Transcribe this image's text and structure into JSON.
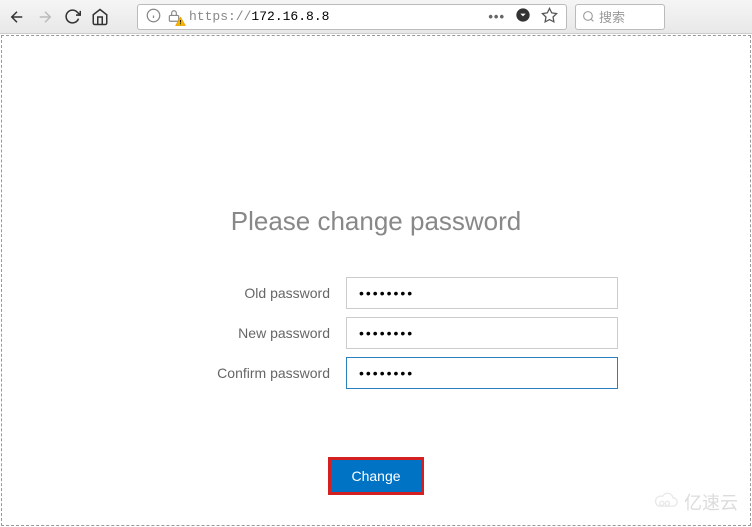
{
  "toolbar": {
    "url_protocol": "https://",
    "url_host": "172.16.8.8",
    "search_placeholder": "搜索"
  },
  "page": {
    "heading": "Please change password",
    "old_label": "Old password",
    "new_label": "New password",
    "confirm_label": "Confirm password",
    "old_value": "••••••••",
    "new_value": "••••••••",
    "confirm_value": "••••••••",
    "change_button": "Change"
  },
  "watermark": {
    "text": "亿速云"
  }
}
